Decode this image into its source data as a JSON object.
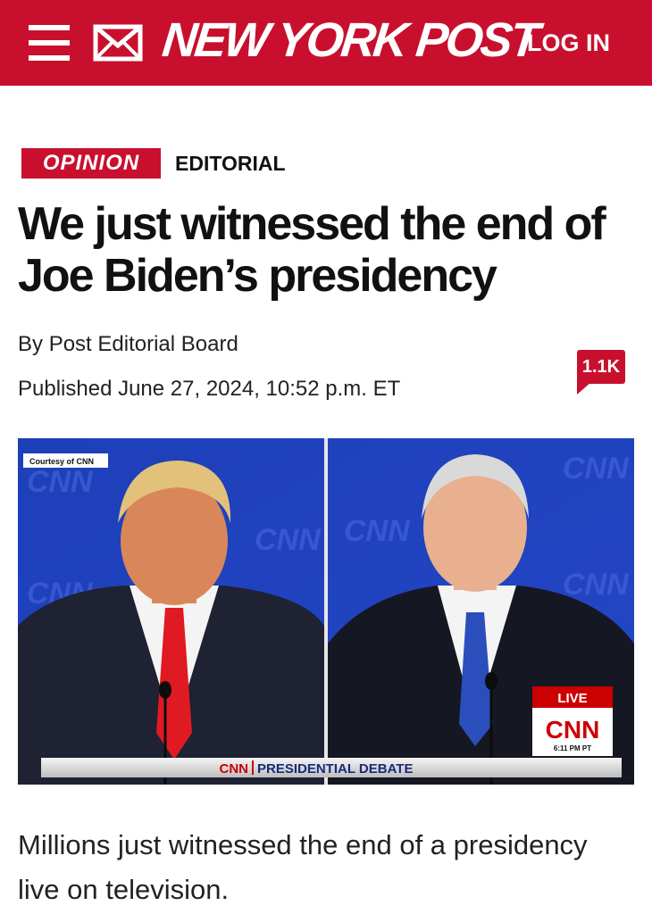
{
  "header": {
    "logo_text": "NEW YORK POST",
    "login_label": "LOG IN",
    "menu_icon": "hamburger-menu-icon",
    "mail_icon": "envelope-icon",
    "brand_color": "#c8102e"
  },
  "article": {
    "section_label": "OPINION",
    "category_label": "EDITORIAL",
    "headline": "We just witnessed the end of Joe Biden’s presidency",
    "byline_prefix": "By ",
    "author": "Post Editorial Board",
    "published": "Published June 27, 2024, 10:52 p.m. ET",
    "comment_count": "1.1K",
    "lede": "Millions just witnessed the end of a presidency live on television."
  },
  "image": {
    "credit": "Courtesy of CNN",
    "watermark": "CNN",
    "live_label": "LIVE",
    "network_logo": "CNN",
    "time": "6:11 PM PT",
    "lower_third_network": "CNN",
    "lower_third_title": "PRESIDENTIAL DEBATE"
  }
}
